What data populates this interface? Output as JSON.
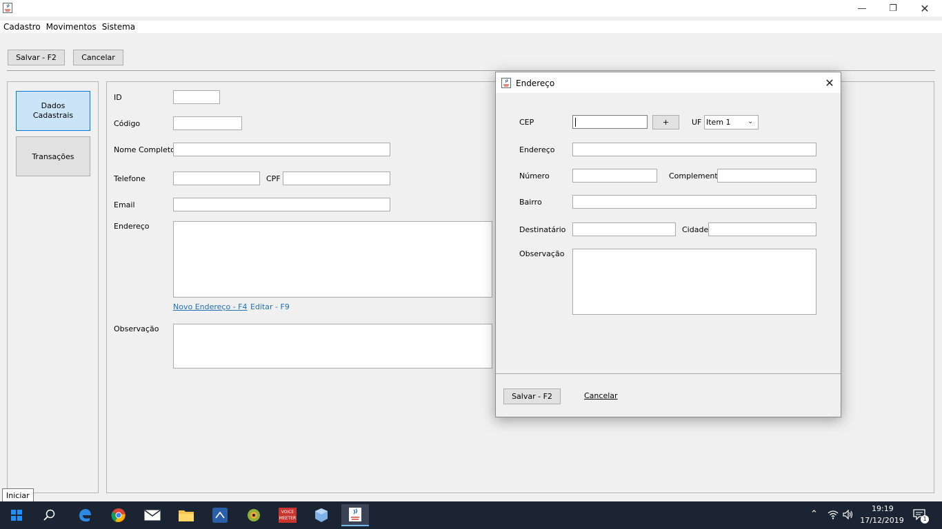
{
  "menu": [
    "Cadastro",
    "Movimentos",
    "Sistema"
  ],
  "toolbar": {
    "save_label": "Salvar - F2",
    "cancel_label": "Cancelar"
  },
  "sidebar": {
    "items": [
      {
        "label": "Dados\nCadastrais"
      },
      {
        "label": "Transações"
      }
    ]
  },
  "form": {
    "id_label": "ID",
    "code_label": "Código",
    "fullname_label": "Nome Completo",
    "phone_label": "Telefone",
    "cpf_label": "CPF",
    "email_label": "Email",
    "address_label": "Endereço",
    "new_address_link": "Novo Endereço - F4",
    "edit_link": "Editar - F9",
    "notes_label": "Observação"
  },
  "dialog": {
    "title": "Endereço",
    "cep_label": "CEP",
    "cep_add_label": "+",
    "uf_label": "UF",
    "uf_selected": "Item 1",
    "address_label": "Endereço",
    "number_label": "Número",
    "complement_label": "Complemento",
    "district_label": "Bairro",
    "recipient_label": "Destinatário",
    "city_label": "Cidade",
    "notes_label": "Observação",
    "save_label": "Salvar - F2",
    "cancel_label": "Cancelar"
  },
  "tooltip": "Iniciar",
  "taskbar": {
    "icons": [
      "windows-start-icon",
      "search-icon",
      "edge-icon",
      "chrome-icon",
      "mail-icon",
      "file-explorer-icon",
      "vscode-icon",
      "app-icon",
      "voicemeeter-icon",
      "virtualbox-icon",
      "java-icon"
    ],
    "voicemeeter_text": "VOICE\nMEETER",
    "time": "19:19",
    "date": "17/12/2019",
    "notification_count": "1"
  }
}
